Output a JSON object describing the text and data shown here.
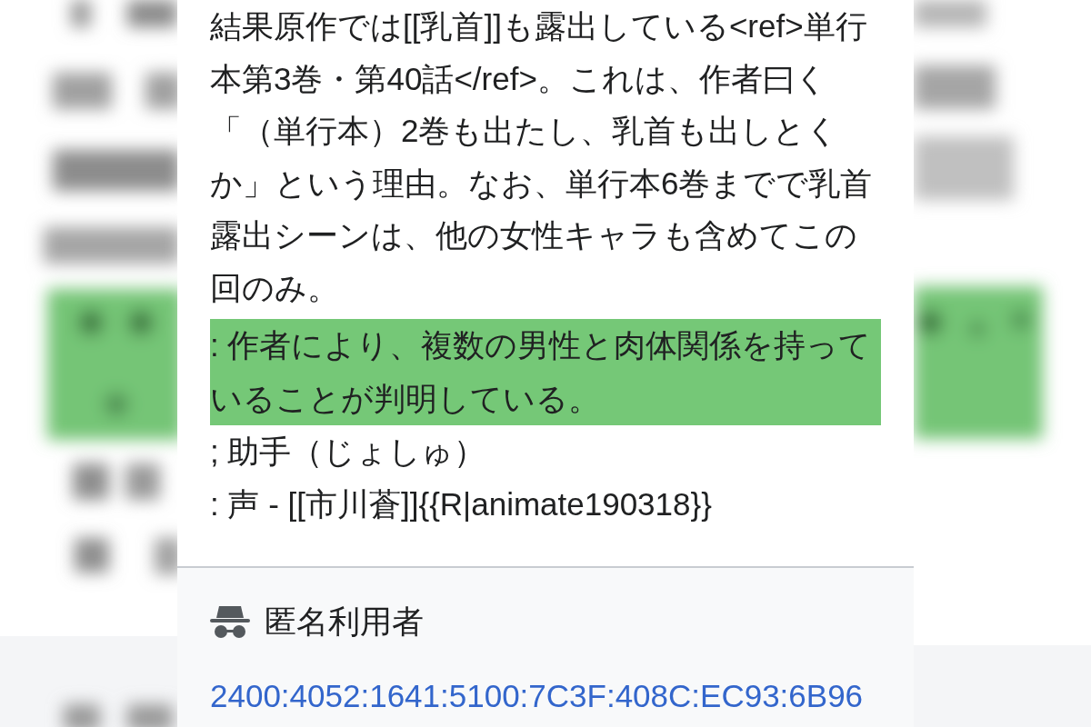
{
  "diff": {
    "lines": [
      {
        "text": "結果原作では[[乳首]]も露出している<ref>単行本第3巻・第40話</ref>。これは、作者曰く「（単行本）2巻も出たし、乳首も出しとくか」という理由。なお、単行本6巻までで乳首露出シーンは、他の女性キャラも含めてこの回のみ。",
        "added": false
      },
      {
        "text": ": 作者により、複数の男性と肉体関係を持っていることが判明している。",
        "added": true
      },
      {
        "text": "; 助手（じょしゅ）",
        "added": false
      },
      {
        "text": ": 声 - [[市川蒼]]{{R|animate190318}}",
        "added": false
      }
    ]
  },
  "editor": {
    "name": "匿名利用者",
    "ip_address": "2400:4052:1641:5100:7C3F:408C:EC93:6B96"
  }
}
